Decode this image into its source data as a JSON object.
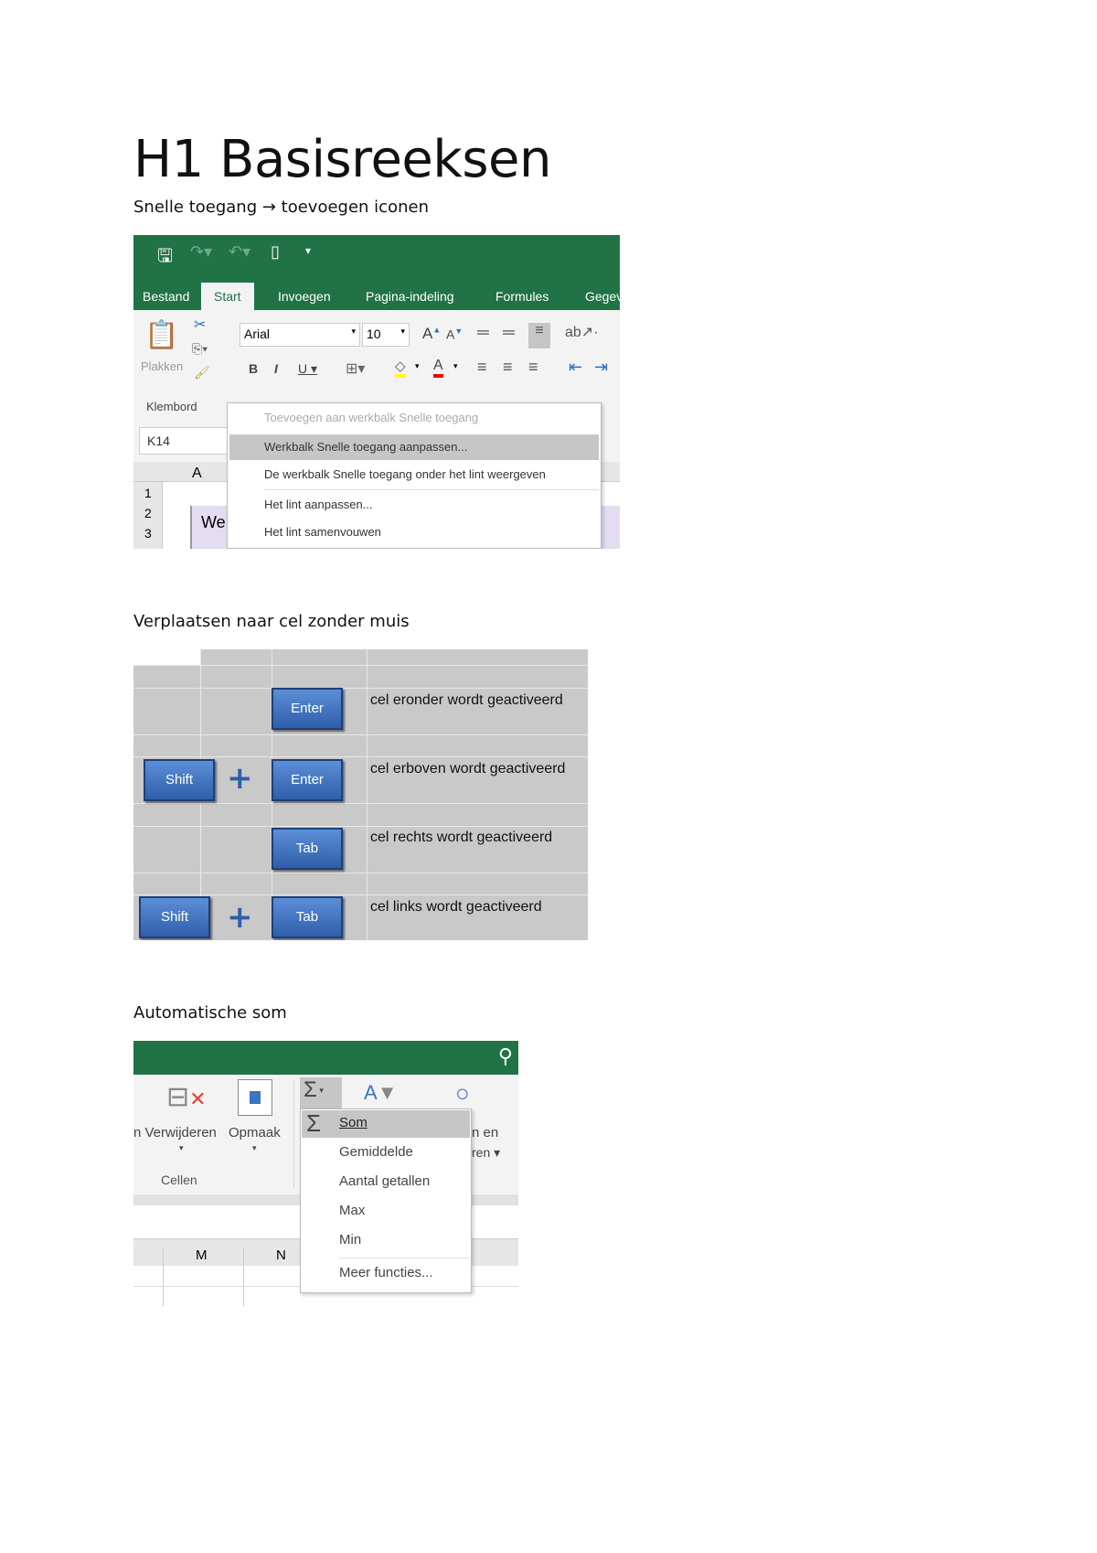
{
  "title": "H1 Basisreeksen",
  "sections": [
    {
      "heading": "Snelle toegang → toevoegen iconen"
    },
    {
      "heading": "Verplaatsen naar cel zonder muis"
    },
    {
      "heading": "Automatische som"
    }
  ],
  "excel1": {
    "tabs": [
      "Bestand",
      "Start",
      "Invoegen",
      "Pagina-indeling",
      "Formules",
      "Gegev"
    ],
    "paste_label": "Plakken",
    "clipboard_group": "Klembord",
    "font_name": "Arial",
    "font_size": "10",
    "name_box": "K14",
    "col_a": "A",
    "rows": [
      "1",
      "2",
      "3"
    ],
    "cell_text": "We",
    "menu": [
      "Toevoegen aan werkbalk Snelle toegang",
      "Werkbalk Snelle toegang aanpassen...",
      "De werkbalk Snelle toegang onder het lint weergeven",
      "Het lint aanpassen...",
      "Het lint samenvouwen"
    ]
  },
  "keys": {
    "rows": [
      {
        "keys": [
          "Enter"
        ],
        "desc": "cel eronder wordt geactiveerd"
      },
      {
        "keys": [
          "Shift",
          "Enter"
        ],
        "desc": "cel erboven wordt geactiveerd"
      },
      {
        "keys": [
          "Tab"
        ],
        "desc": "cel rechts wordt geactiveerd"
      },
      {
        "keys": [
          "Shift",
          "Tab"
        ],
        "desc": "cel links wordt geactiveerd"
      }
    ],
    "plus": "+"
  },
  "excel2": {
    "delete_label": "n Verwijderen",
    "format_label": "Opmaak",
    "group": "Cellen",
    "right_label_1": "n en",
    "right_label_2": "ren ▾",
    "cols": [
      "M",
      "N"
    ],
    "menu": [
      "Som",
      "Gemiddelde",
      "Aantal getallen",
      "Max",
      "Min",
      "Meer functies..."
    ]
  },
  "colors": {
    "excel_green": "#217346",
    "key_blue": "#2f5fa8"
  }
}
